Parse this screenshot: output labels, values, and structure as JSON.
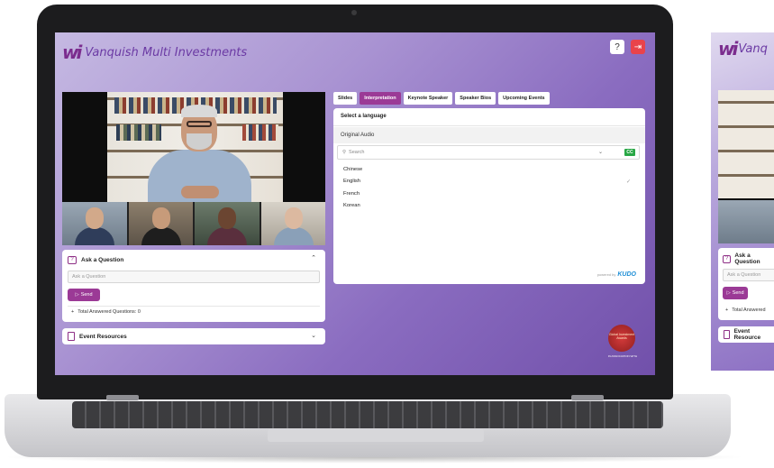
{
  "app": {
    "brand": "Vanquish Multi Investments",
    "brand_short": "Vanq",
    "logo_mark": "wi"
  },
  "header": {
    "help_icon": "question-circle-icon",
    "exit_icon": "logout-icon"
  },
  "tabs": [
    {
      "label": "Slides",
      "active": false
    },
    {
      "label": "Interpretation",
      "active": true
    },
    {
      "label": "Keynote Speaker",
      "active": false
    },
    {
      "label": "Speaker Bios",
      "active": false
    },
    {
      "label": "Upcoming Events",
      "active": false
    }
  ],
  "interpretation": {
    "title": "Select a language",
    "original_audio": "Original Audio",
    "search_placeholder": "Search",
    "cc_label": "CC",
    "languages": [
      {
        "name": "Chinese",
        "selected": false
      },
      {
        "name": "English",
        "selected": true
      },
      {
        "name": "French",
        "selected": false
      },
      {
        "name": "Korean",
        "selected": false
      }
    ],
    "powered_by": "powered by",
    "provider": "KUDO"
  },
  "ask": {
    "title": "Ask a Question",
    "placeholder": "Ask a Question",
    "send_label": "Send",
    "answered_label": "Total Answered Questions: 0",
    "ask_short": "Ask a Question",
    "answered_short": "Total Answered"
  },
  "resources": {
    "title": "Event Resources",
    "title_short": "Event Resource"
  },
  "award": {
    "badge_text": "Global Investment Awards",
    "caption": "IN ASSOCIATION WITH"
  },
  "colors": {
    "accent": "#9b3a96",
    "brand": "#6b3aa4",
    "exit": "#e9434b",
    "cc": "#28a745"
  }
}
